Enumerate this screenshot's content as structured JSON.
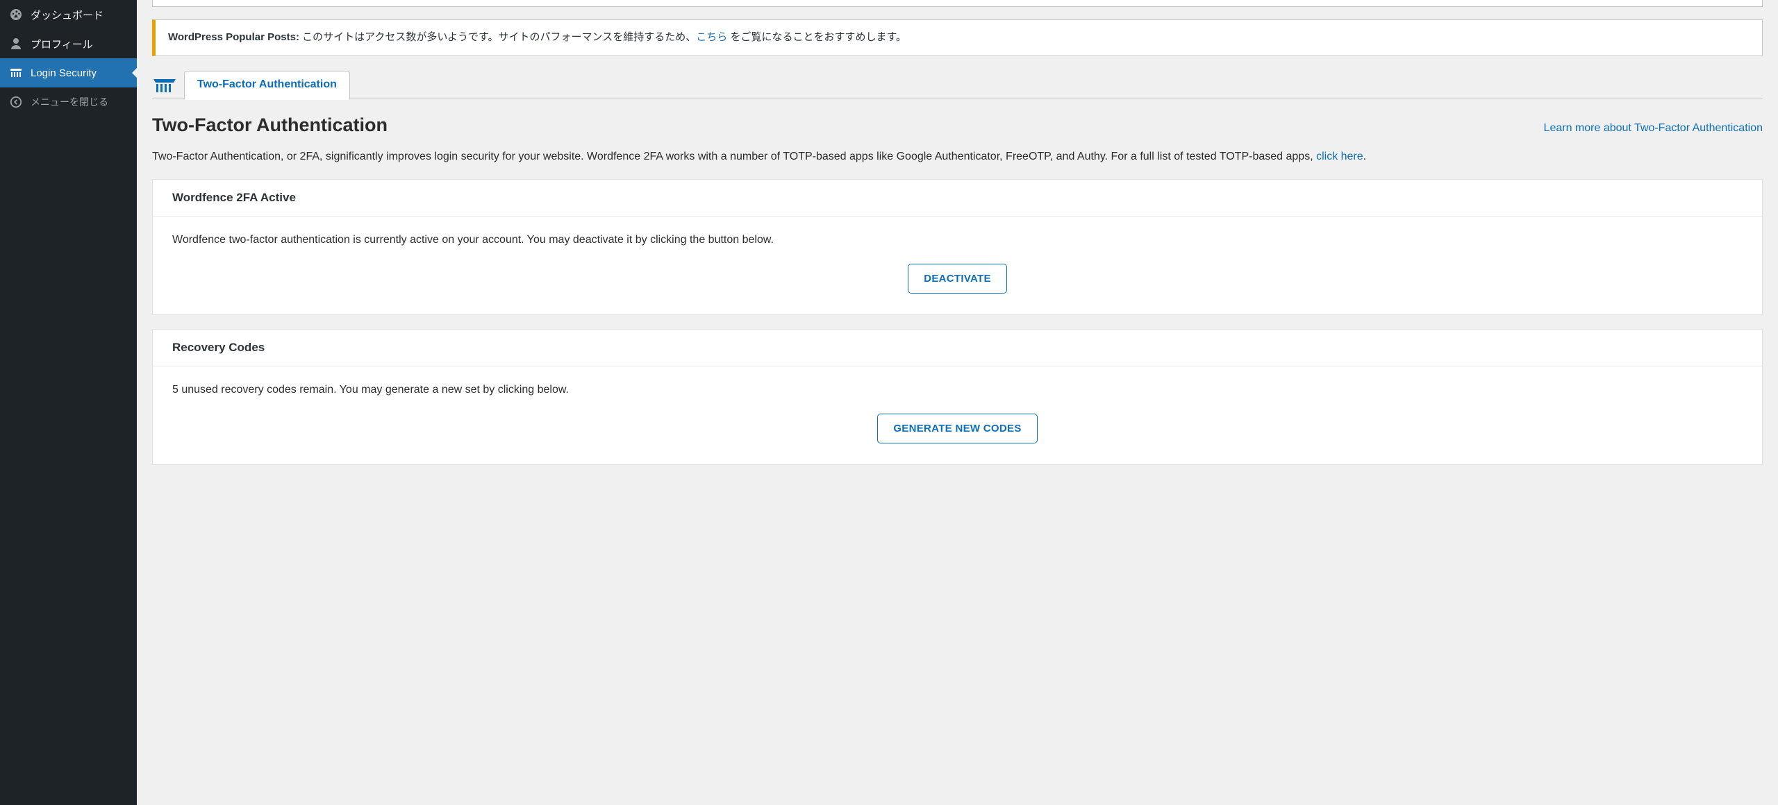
{
  "sidebar": {
    "items": [
      {
        "label": "ダッシュボード"
      },
      {
        "label": "プロフィール"
      },
      {
        "label": "Login Security"
      },
      {
        "label": "メニューを閉じる"
      }
    ]
  },
  "notice": {
    "prefix": "WordPress Popular Posts:",
    "body_before": " このサイトはアクセス数が多いようです。サイトのパフォーマンスを維持するため、",
    "link": "こちら",
    "body_after": " をご覧になることをおすすめします。"
  },
  "tab": {
    "label": "Two-Factor Authentication"
  },
  "heading": {
    "title": "Two-Factor Authentication",
    "learn_more": "Learn more about Two-Factor Authentication"
  },
  "intro": {
    "text_before": "Two-Factor Authentication, or 2FA, significantly improves login security for your website. Wordfence 2FA works with a number of TOTP-based apps like Google Authenticator, FreeOTP, and Authy. For a full list of tested TOTP-based apps, ",
    "link": "click here",
    "text_after": "."
  },
  "card_active": {
    "title": "Wordfence 2FA Active",
    "body": "Wordfence two-factor authentication is currently active on your account. You may deactivate it by clicking the button below.",
    "button": "DEACTIVATE"
  },
  "card_recovery": {
    "title": "Recovery Codes",
    "body": "5 unused recovery codes remain. You may generate a new set by clicking below.",
    "button": "GENERATE NEW CODES"
  }
}
